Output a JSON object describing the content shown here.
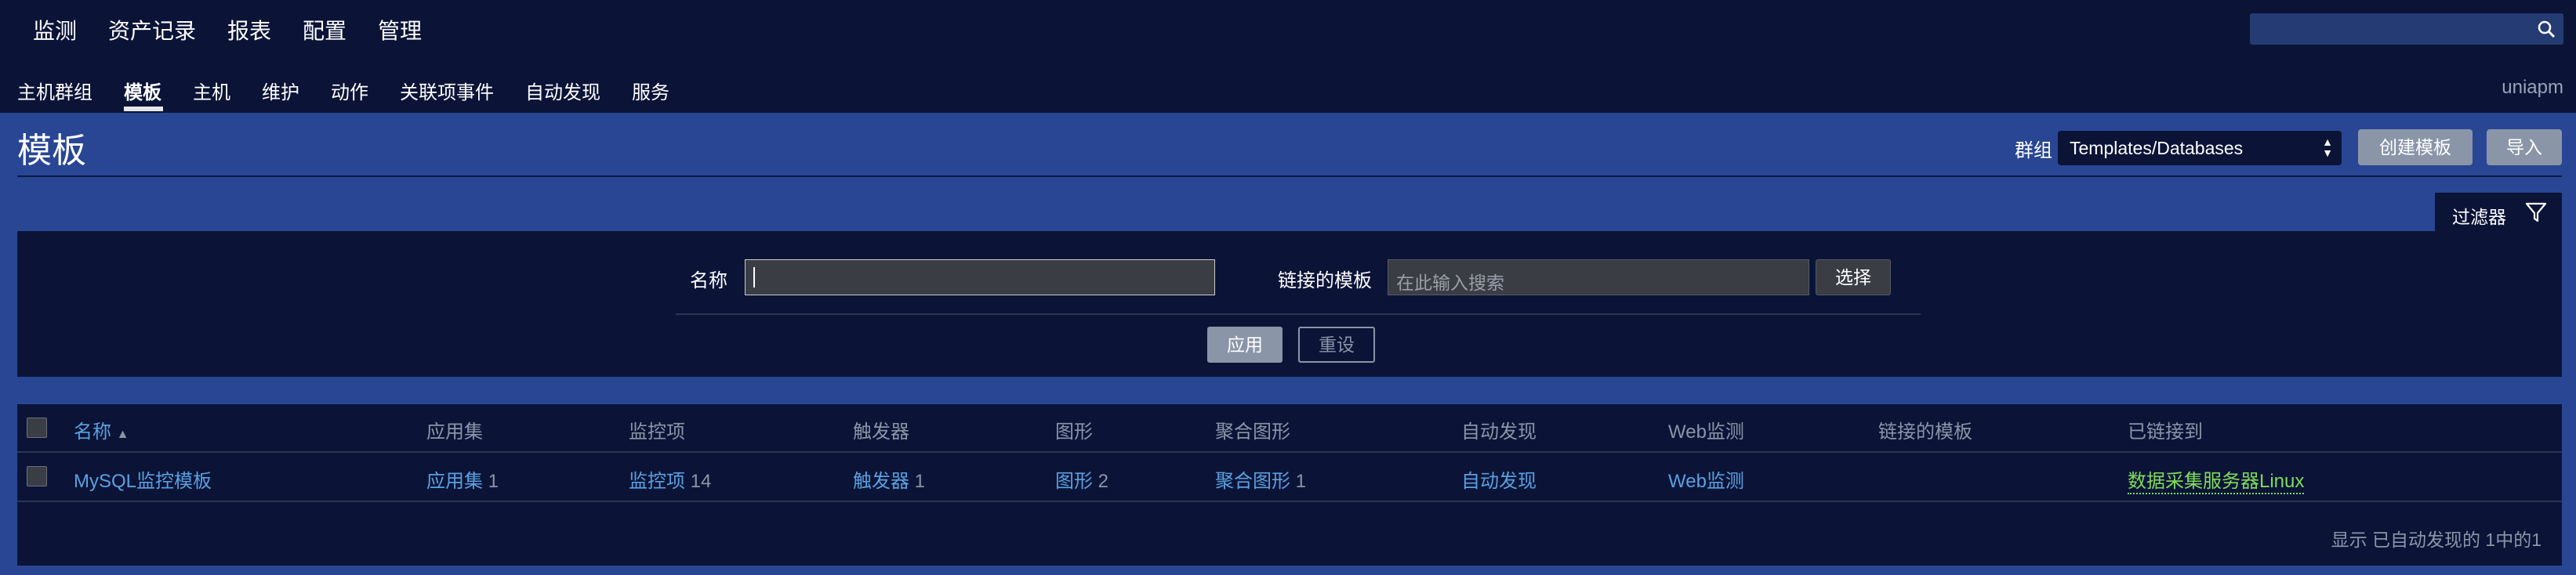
{
  "top_menu": {
    "items": [
      "监测",
      "资产记录",
      "报表",
      "配置",
      "管理"
    ]
  },
  "sub_menu": {
    "items": [
      "主机群组",
      "模板",
      "主机",
      "维护",
      "动作",
      "关联项事件",
      "自动发现",
      "服务"
    ],
    "active": "模板",
    "user": "uniapm"
  },
  "page": {
    "title": "模板",
    "group_label": "群组",
    "group_value": "Templates/Databases",
    "create_button": "创建模板",
    "import_button": "导入"
  },
  "filter": {
    "tab_label": "过滤器",
    "name_label": "名称",
    "name_value": "",
    "linked_label": "链接的模板",
    "linked_placeholder": "在此输入搜索",
    "select_button": "选择",
    "apply_button": "应用",
    "reset_button": "重设"
  },
  "table": {
    "headers": {
      "name": "名称",
      "sort_indicator": "▲",
      "applications": "应用集",
      "items": "监控项",
      "triggers": "触发器",
      "graphs": "图形",
      "screens": "聚合图形",
      "discovery": "自动发现",
      "web": "Web监测",
      "linked_templates": "链接的模板",
      "linked_to": "已链接到"
    },
    "rows": [
      {
        "name": "MySQL监控模板",
        "applications": "应用集",
        "applications_count": "1",
        "items": "监控项",
        "items_count": "14",
        "triggers": "触发器",
        "triggers_count": "1",
        "graphs": "图形",
        "graphs_count": "2",
        "screens": "聚合图形",
        "screens_count": "1",
        "discovery": "自动发现",
        "web": "Web监测",
        "linked_templates": "",
        "linked_to": "数据采集服务器Linux"
      }
    ],
    "summary": "显示 已自动发现的 1中的1"
  },
  "colors": {
    "background": "#0b1437",
    "panel": "#284693",
    "link": "#5aa0e0",
    "linked_host": "#7edc5a",
    "button": "#8a95a8"
  }
}
